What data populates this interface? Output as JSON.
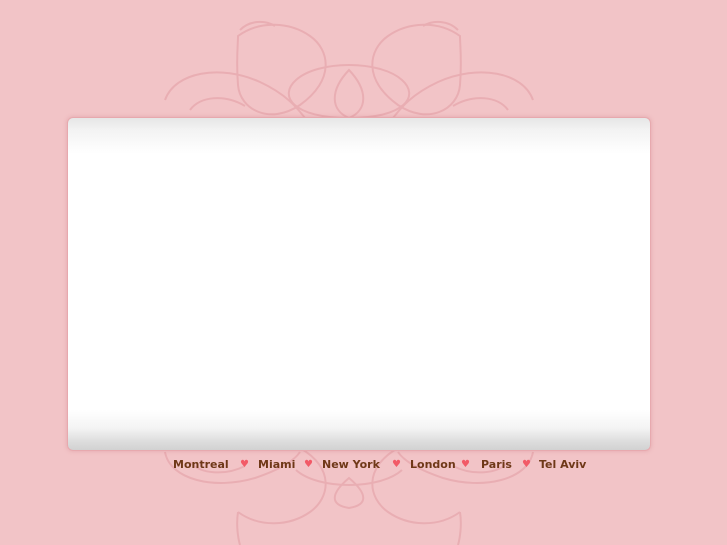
{
  "page": {
    "background_color": "#f2c4c7",
    "panel_color": "#ffffff",
    "link_color": "#6f3818",
    "heart_color": "#f25a67",
    "ornament_color": "#e7a7ad"
  },
  "nav": {
    "separator_icon": "heart-icon",
    "separator_glyph": "♥",
    "items": [
      {
        "label": "Montreal"
      },
      {
        "label": "Miami"
      },
      {
        "label": "New York"
      },
      {
        "label": "London"
      },
      {
        "label": "Paris"
      },
      {
        "label": "Tel Aviv"
      }
    ]
  }
}
